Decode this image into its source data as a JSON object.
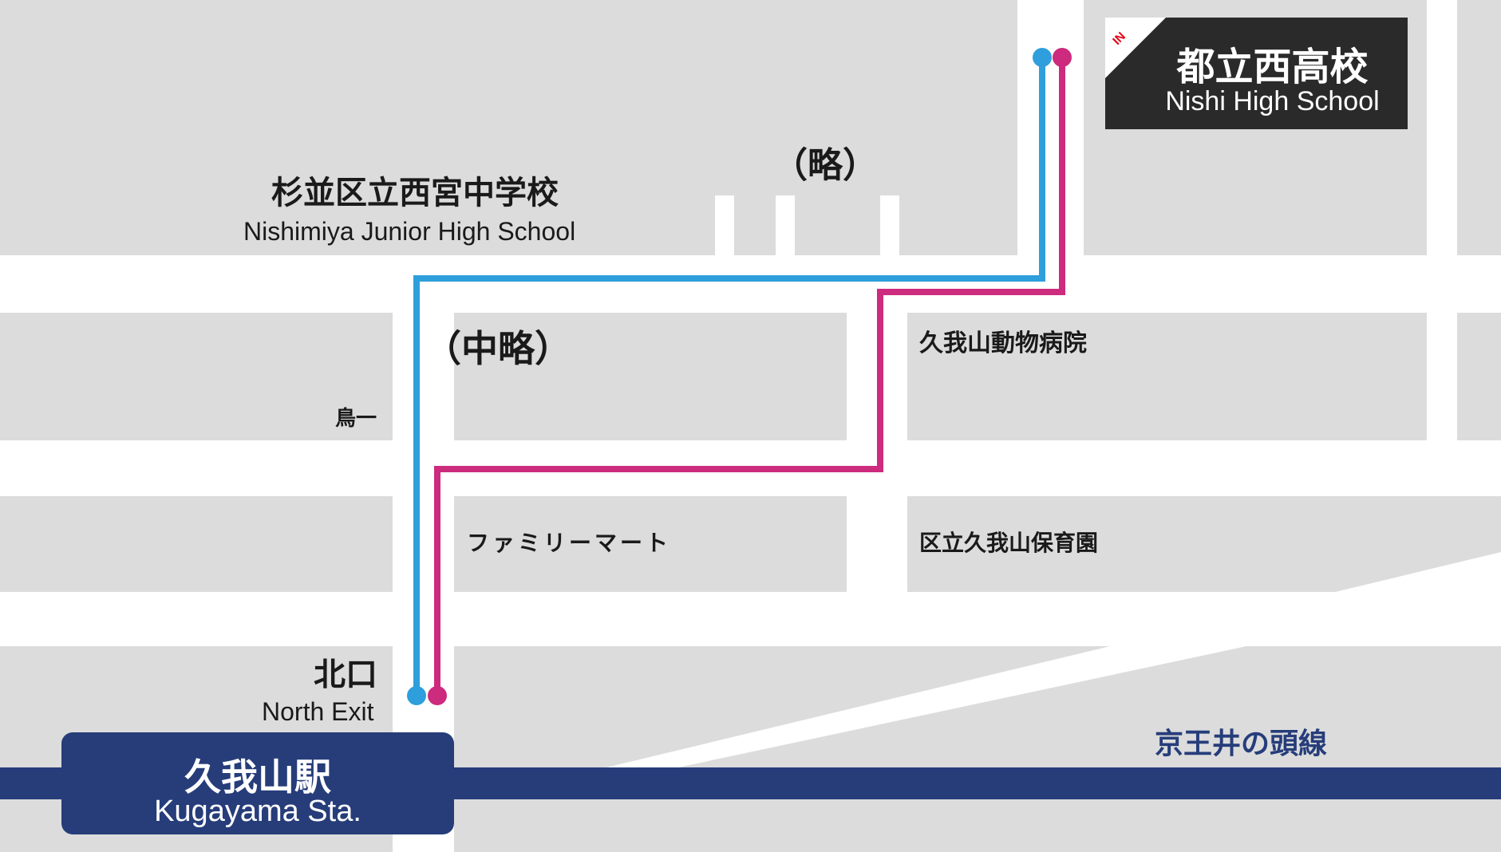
{
  "colors": {
    "background": "#ffffff",
    "block": "#dcdcdc",
    "route_blue": "#2e9fdc",
    "route_magenta": "#cc2b7e",
    "rail_line": "#263d7a",
    "station_card": "#263d7a",
    "school_card": "#2a2a2a",
    "in_tag_text": "#e60012",
    "rail_label": "#263d7a"
  },
  "destination": {
    "tag": "IN",
    "name_ja": "都立西高校",
    "name_en": "Nishi High School"
  },
  "station": {
    "name_ja": "久我山駅",
    "name_en": "Kugayama Sta."
  },
  "exit": {
    "name_ja": "北口",
    "name_en": "North Exit"
  },
  "rail_line": {
    "name": "京王井の頭線"
  },
  "landmarks": {
    "junior_high_ja": "杉並区立西宮中学校",
    "junior_high_en": "Nishimiya Junior High School",
    "omitted_top": "（略）",
    "omitted_middle": "（中略）",
    "tori": "鳥一",
    "animal_hospital": "久我山動物病院",
    "family_mart": "ファミリーマート",
    "nursery": "区立久我山保育園"
  },
  "routes": [
    {
      "name": "blue-route",
      "color_key": "route_blue"
    },
    {
      "name": "magenta-route",
      "color_key": "route_magenta"
    }
  ]
}
